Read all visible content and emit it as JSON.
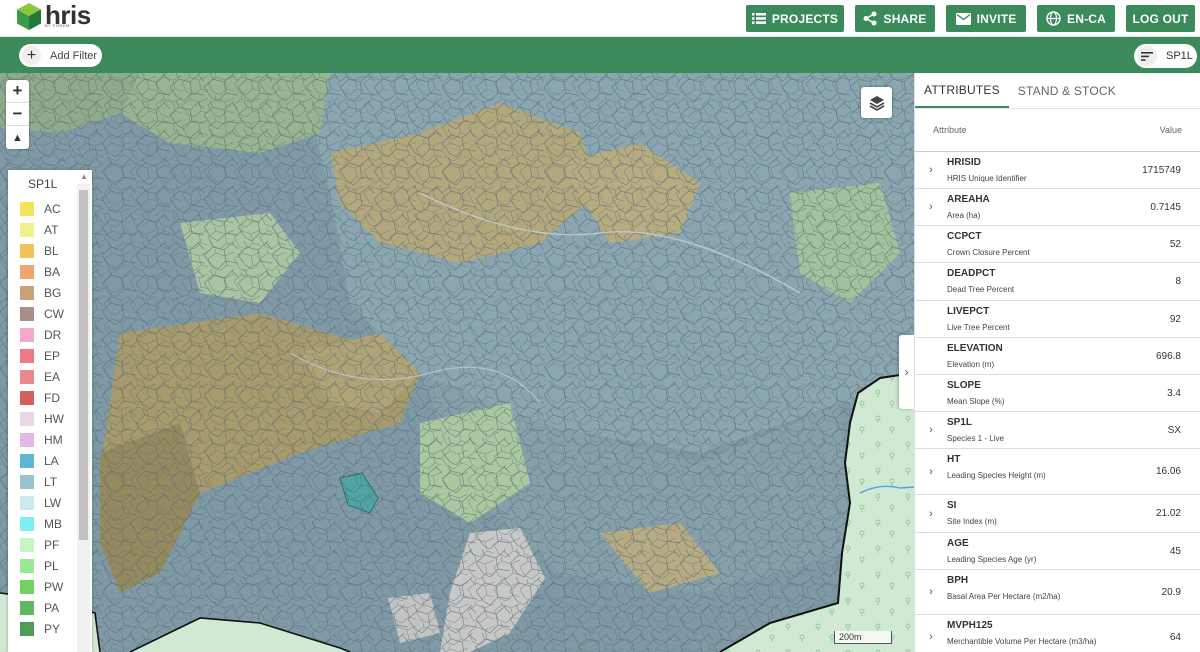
{
  "app": {
    "logo_text": "hris",
    "logo_sub": "BY FOREM"
  },
  "toolbar": {
    "projects_label": "PROJECTS",
    "share_label": "SHARE",
    "invite_label": "INVITE",
    "language_label": "EN-CA",
    "logout_label": "LOG OUT"
  },
  "filterbar": {
    "add_filter_label": "Add Filter",
    "layer_chip_label": "SP1L"
  },
  "map": {
    "zoom_in": "+",
    "zoom_out": "−",
    "reset_north": "▲",
    "scale_label": "200m"
  },
  "legend": {
    "title": "SP1L",
    "items": [
      {
        "code": "AC",
        "color": "#f4e45a"
      },
      {
        "code": "AT",
        "color": "#f2f08a"
      },
      {
        "code": "BL",
        "color": "#f2c35a"
      },
      {
        "code": "BA",
        "color": "#efa56e"
      },
      {
        "code": "BG",
        "color": "#c9a07a"
      },
      {
        "code": "CW",
        "color": "#a88f8a"
      },
      {
        "code": "DR",
        "color": "#f2a8cf"
      },
      {
        "code": "EP",
        "color": "#ef7a86"
      },
      {
        "code": "EA",
        "color": "#e9898e"
      },
      {
        "code": "FD",
        "color": "#d26060"
      },
      {
        "code": "HW",
        "color": "#ead6e6"
      },
      {
        "code": "HM",
        "color": "#e3b9e3"
      },
      {
        "code": "LA",
        "color": "#5fb7d6"
      },
      {
        "code": "LT",
        "color": "#9cc2d0"
      },
      {
        "code": "LW",
        "color": "#cfe8ef"
      },
      {
        "code": "MB",
        "color": "#7beff0"
      },
      {
        "code": "PF",
        "color": "#c9f5c5"
      },
      {
        "code": "PL",
        "color": "#9be892"
      },
      {
        "code": "PW",
        "color": "#6fd262"
      },
      {
        "code": "PA",
        "color": "#5fb860"
      },
      {
        "code": "PY",
        "color": "#4f9c55"
      }
    ]
  },
  "panel": {
    "tabs": [
      "ATTRIBUTES",
      "STAND & STOCK"
    ],
    "header_attribute": "Attribute",
    "header_value": "Value",
    "rows": [
      {
        "name": "HRISID",
        "desc": "HRIS Unique Identifier",
        "value": "1715749",
        "expandable": true
      },
      {
        "name": "AREAHA",
        "desc": "Area (ha)",
        "value": "0.7145",
        "expandable": true
      },
      {
        "name": "CCPCT",
        "desc": "Crown Closure Percent",
        "value": "52",
        "expandable": false
      },
      {
        "name": "DEADPCT",
        "desc": "Dead Tree Percent",
        "value": "8",
        "expandable": false
      },
      {
        "name": "LIVEPCT",
        "desc": "Live Tree Percent",
        "value": "92",
        "expandable": false
      },
      {
        "name": "ELEVATION",
        "desc": "Elevation (m)",
        "value": "696.8",
        "expandable": false
      },
      {
        "name": "SLOPE",
        "desc": "Mean Slope (%)",
        "value": "3.4",
        "expandable": false
      },
      {
        "name": "SP1L",
        "desc": "Species 1 - Live",
        "value": "SX",
        "expandable": true
      },
      {
        "name": "HT",
        "desc": "Leading Species Height (m)",
        "value": "16.06",
        "expandable": true
      },
      {
        "name": "SI",
        "desc": "Site Index (m)",
        "value": "21.02",
        "expandable": true
      },
      {
        "name": "AGE",
        "desc": "Leading Species Age (yr)",
        "value": "45",
        "expandable": false
      },
      {
        "name": "BPH",
        "desc": "Basal Area Per Hectare (m2/ha)",
        "value": "20.9",
        "expandable": true
      },
      {
        "name": "MVPH125",
        "desc": "Merchantible Volume Per Hectare (m3/ha)",
        "value": "64",
        "expandable": true
      }
    ]
  }
}
